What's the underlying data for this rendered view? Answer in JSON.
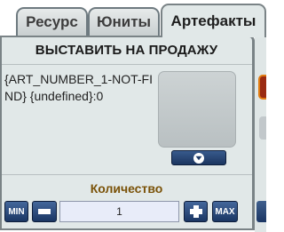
{
  "tabs": [
    {
      "label": "Ресурс"
    },
    {
      "label": "Юниты"
    },
    {
      "label": "Артефакты"
    }
  ],
  "sell": {
    "title": "ВЫСТАВИТЬ НА ПРОДАЖУ",
    "artifact_info": "{ART_NUMBER_1-NOT-FIND} {undefined}:0"
  },
  "quantity": {
    "label": "Количество",
    "value": "1",
    "min_label": "MIN",
    "max_label": "MAX"
  },
  "icons": {
    "minus": "minus-icon",
    "plus": "plus-icon",
    "dropdown": "chevron-down-icon"
  },
  "colors": {
    "panel": "#e1e8e8",
    "button": "#2b4a7c",
    "quantity_label": "#7a5208"
  }
}
